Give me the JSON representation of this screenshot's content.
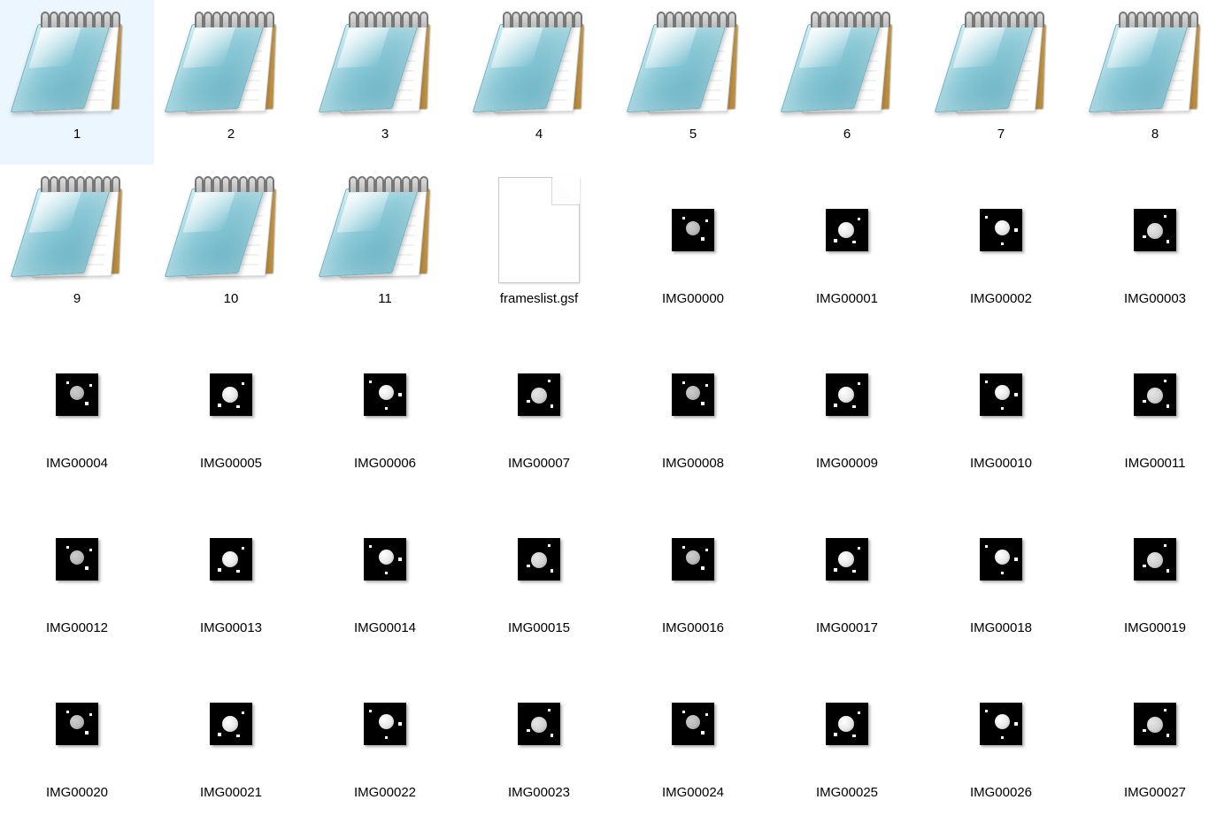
{
  "files": [
    {
      "name": "1",
      "type": "text"
    },
    {
      "name": "2",
      "type": "text"
    },
    {
      "name": "3",
      "type": "text"
    },
    {
      "name": "4",
      "type": "text"
    },
    {
      "name": "5",
      "type": "text"
    },
    {
      "name": "6",
      "type": "text"
    },
    {
      "name": "7",
      "type": "text"
    },
    {
      "name": "8",
      "type": "text"
    },
    {
      "name": "9",
      "type": "text"
    },
    {
      "name": "10",
      "type": "text"
    },
    {
      "name": "11",
      "type": "text"
    },
    {
      "name": "frameslist.gsf",
      "type": "generic"
    },
    {
      "name": "IMG00000",
      "type": "image"
    },
    {
      "name": "IMG00001",
      "type": "image"
    },
    {
      "name": "IMG00002",
      "type": "image"
    },
    {
      "name": "IMG00003",
      "type": "image"
    },
    {
      "name": "IMG00004",
      "type": "image"
    },
    {
      "name": "IMG00005",
      "type": "image"
    },
    {
      "name": "IMG00006",
      "type": "image"
    },
    {
      "name": "IMG00007",
      "type": "image"
    },
    {
      "name": "IMG00008",
      "type": "image"
    },
    {
      "name": "IMG00009",
      "type": "image"
    },
    {
      "name": "IMG00010",
      "type": "image"
    },
    {
      "name": "IMG00011",
      "type": "image"
    },
    {
      "name": "IMG00012",
      "type": "image"
    },
    {
      "name": "IMG00013",
      "type": "image"
    },
    {
      "name": "IMG00014",
      "type": "image"
    },
    {
      "name": "IMG00015",
      "type": "image"
    },
    {
      "name": "IMG00016",
      "type": "image"
    },
    {
      "name": "IMG00017",
      "type": "image"
    },
    {
      "name": "IMG00018",
      "type": "image"
    },
    {
      "name": "IMG00019",
      "type": "image"
    },
    {
      "name": "IMG00020",
      "type": "image"
    },
    {
      "name": "IMG00021",
      "type": "image"
    },
    {
      "name": "IMG00022",
      "type": "image"
    },
    {
      "name": "IMG00023",
      "type": "image"
    },
    {
      "name": "IMG00024",
      "type": "image"
    },
    {
      "name": "IMG00025",
      "type": "image"
    },
    {
      "name": "IMG00026",
      "type": "image"
    },
    {
      "name": "IMG00027",
      "type": "image"
    }
  ]
}
